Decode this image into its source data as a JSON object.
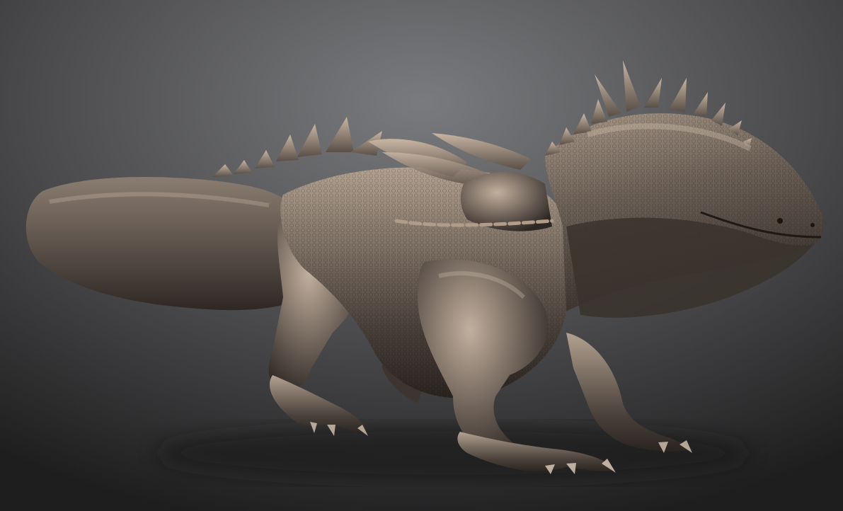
{
  "scene": {
    "subject": "sculpted-creature",
    "colors": {
      "background_top": "#7a7b7e",
      "background_bottom": "#1e1e1f",
      "skin_highlight": "#c9b6a4",
      "skin_mid": "#6e6258",
      "skin_dark": "#2a2420",
      "shadow": "#141414"
    }
  }
}
